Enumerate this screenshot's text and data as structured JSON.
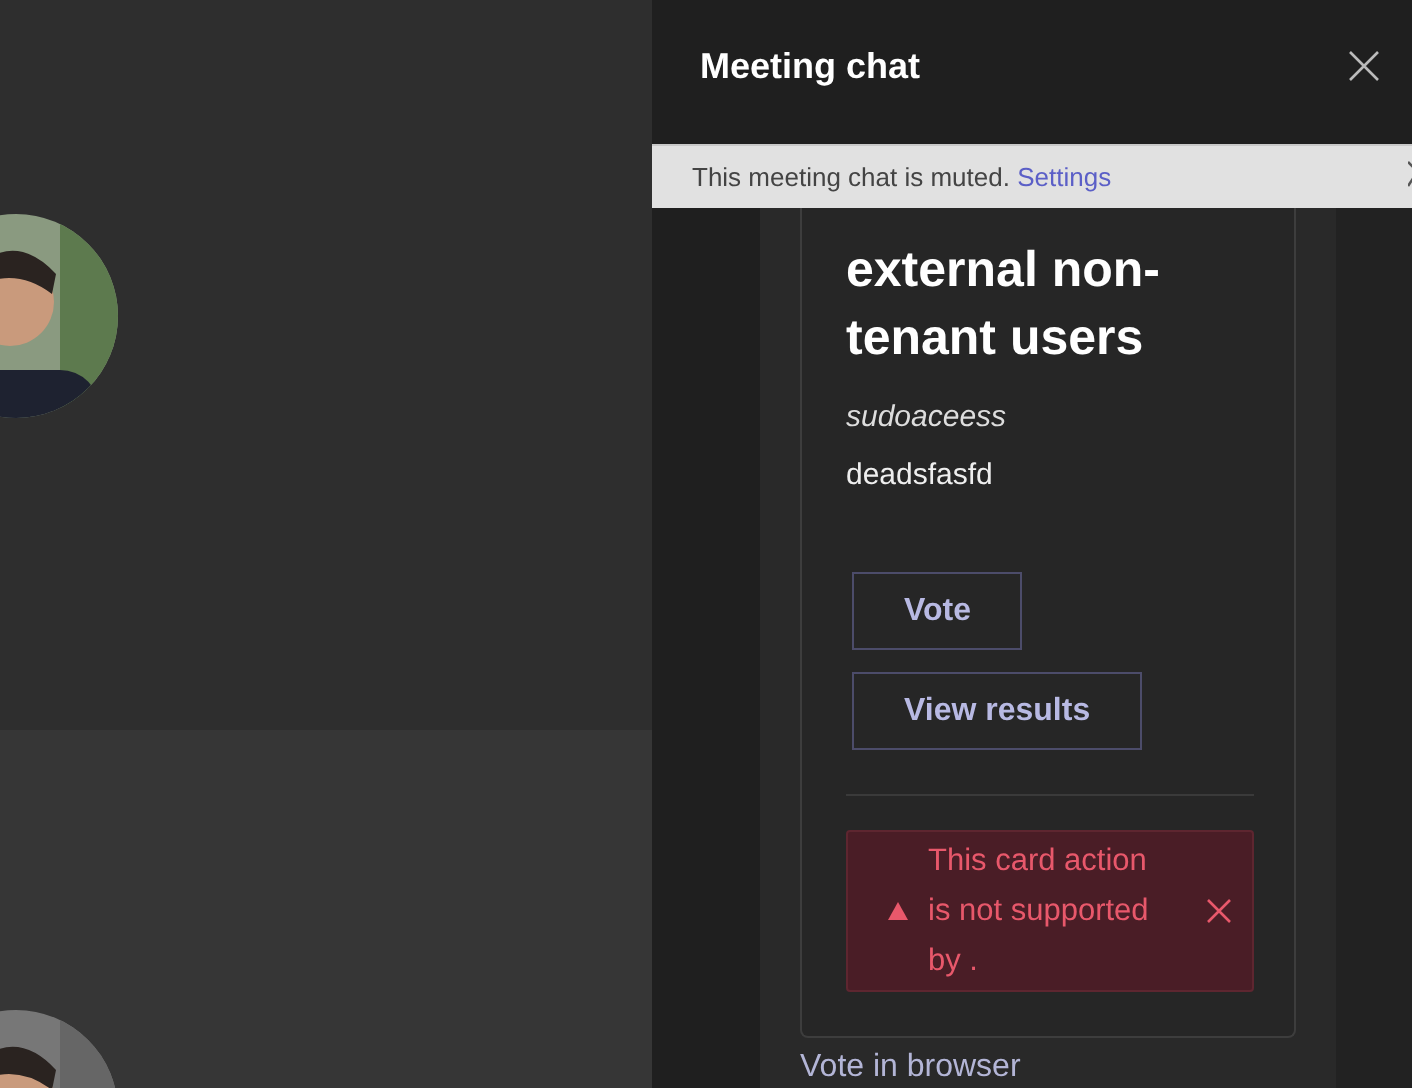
{
  "chat_panel": {
    "title": "Meeting chat",
    "banner": {
      "text": "This meeting chat is muted.",
      "link": "Settings"
    },
    "card": {
      "title": "external non-tenant users",
      "author": "sudoaceess",
      "body": "deadsfasfd",
      "actions": [
        "Vote",
        "View results"
      ],
      "error": {
        "text": "This card action is not supported by ."
      }
    },
    "footer_link": "Vote in browser"
  }
}
